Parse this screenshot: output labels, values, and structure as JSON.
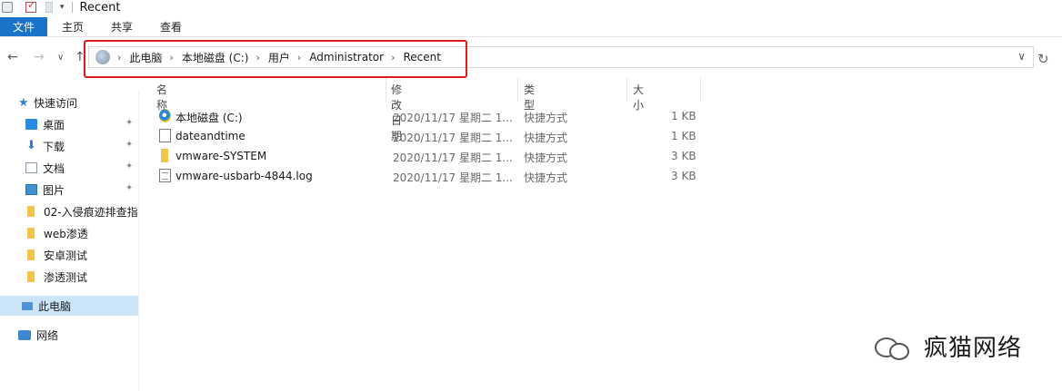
{
  "window": {
    "title": "Recent"
  },
  "ribbon": {
    "tabs": [
      "文件",
      "主页",
      "共享",
      "查看"
    ]
  },
  "address": {
    "crumbs": [
      "此电脑",
      "本地磁盘 (C:)",
      "用户",
      "Administrator",
      "Recent"
    ]
  },
  "sidebar": {
    "items": [
      {
        "label": "快速访问",
        "icon": "star-icon",
        "pinned": false
      },
      {
        "label": "桌面",
        "icon": "desktop-icon",
        "pinned": true
      },
      {
        "label": "下载",
        "icon": "download-icon",
        "pinned": true
      },
      {
        "label": "文档",
        "icon": "document-icon",
        "pinned": true
      },
      {
        "label": "图片",
        "icon": "picture-icon",
        "pinned": true
      },
      {
        "label": "02-入侵痕迹排查指",
        "icon": "folder-icon",
        "pinned": false
      },
      {
        "label": "web渗透",
        "icon": "folder-icon",
        "pinned": false
      },
      {
        "label": "安卓测试",
        "icon": "folder-icon",
        "pinned": false
      },
      {
        "label": "渗透测试",
        "icon": "folder-icon",
        "pinned": false
      },
      {
        "label": "此电脑",
        "icon": "computer-icon",
        "pinned": false,
        "selected": true
      },
      {
        "label": "网络",
        "icon": "network-icon",
        "pinned": false
      }
    ]
  },
  "file_list": {
    "columns": [
      "名称",
      "修改日期",
      "类型",
      "大小"
    ],
    "rows": [
      {
        "name": "本地磁盘 (C:)",
        "date": "2020/11/17 星期二 1...",
        "type": "快捷方式",
        "size": "1 KB",
        "icon": "ie-shortcut-icon"
      },
      {
        "name": "dateandtime",
        "date": "2020/11/17 星期二 1...",
        "type": "快捷方式",
        "size": "1 KB",
        "icon": "blank-file-icon"
      },
      {
        "name": "vmware-SYSTEM",
        "date": "2020/11/17 星期二 1...",
        "type": "快捷方式",
        "size": "3 KB",
        "icon": "folder-icon"
      },
      {
        "name": "vmware-usbarb-4844.log",
        "date": "2020/11/17 星期二 1...",
        "type": "快捷方式",
        "size": "3 KB",
        "icon": "log-file-icon"
      }
    ]
  },
  "watermark": {
    "text": "疯猫网络"
  },
  "colors": {
    "file_tab": "#1a73c9",
    "highlight": "#e01a1a",
    "selected": "#cce4f7"
  }
}
